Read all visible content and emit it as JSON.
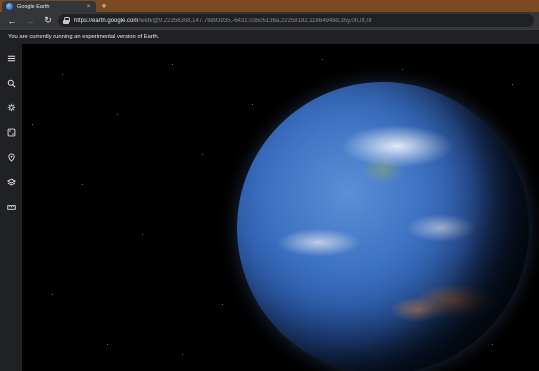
{
  "browser": {
    "tab": {
      "title": "Google Earth",
      "close_glyph": "×"
    },
    "new_tab_glyph": "+",
    "nav": {
      "back_glyph": "←",
      "forward_glyph": "→",
      "reload_glyph": "↻"
    },
    "address": {
      "host": "https://earth.google.com",
      "path": "/web/@9.22356308,147.78893935,-6431.03505136a,22258182.11864948d,35y,0h,0t,0r"
    }
  },
  "infobar": {
    "message": "You are currently running an experimental version of Earth."
  },
  "sidebar": {
    "items": [
      {
        "icon": "menu-icon"
      },
      {
        "icon": "search-icon"
      },
      {
        "icon": "voyager-icon"
      },
      {
        "icon": "feeling-lucky-icon"
      },
      {
        "icon": "projects-icon"
      },
      {
        "icon": "map-style-icon"
      },
      {
        "icon": "measure-icon"
      }
    ]
  },
  "colors": {
    "tabstrip": "#7a4a22",
    "toolbar": "#35363a",
    "sidebar": "#202124",
    "space": "#000000"
  }
}
